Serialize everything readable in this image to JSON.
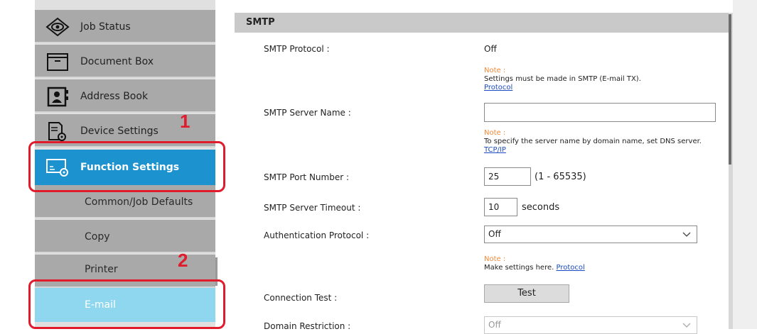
{
  "sidebar": {
    "items": [
      {
        "label": "Job Status",
        "icon": "eye-icon"
      },
      {
        "label": "Document Box",
        "icon": "folder-icon"
      },
      {
        "label": "Address Book",
        "icon": "address-book-icon"
      },
      {
        "label": "Device Settings",
        "icon": "device-settings-icon"
      },
      {
        "label": "Function Settings",
        "icon": "function-settings-icon",
        "active": true
      },
      {
        "label": "Common/Job Defaults"
      },
      {
        "label": "Copy"
      },
      {
        "label": "Printer"
      },
      {
        "label": "E-mail",
        "selected": true
      }
    ]
  },
  "callouts": {
    "one": "1",
    "two": "2"
  },
  "section": {
    "title": "SMTP"
  },
  "fields": {
    "smtp_protocol": {
      "label": "SMTP Protocol :",
      "value": "Off",
      "note_title": "Note :",
      "note_text": "Settings must be made in SMTP (E-mail TX).",
      "note_link": "Protocol"
    },
    "server_name": {
      "label": "SMTP Server Name :",
      "value": "",
      "note_title": "Note :",
      "note_text": "To specify the server name by domain name, set DNS server.",
      "note_link": "TCP/IP"
    },
    "port": {
      "label": "SMTP Port Number :",
      "value": "25",
      "range": "(1 - 65535)"
    },
    "timeout": {
      "label": "SMTP Server Timeout :",
      "value": "10",
      "unit": "seconds"
    },
    "auth": {
      "label": "Authentication Protocol :",
      "value": "Off",
      "note_title": "Note :",
      "note_text": "Make settings here.",
      "note_link": "Protocol"
    },
    "conn_test": {
      "label": "Connection Test :",
      "button": "Test"
    },
    "domain": {
      "label": "Domain Restriction :",
      "value": "Off"
    }
  },
  "colors": {
    "active": "#1c92cf",
    "selected": "#8fd7ee",
    "callout": "#e01b2b",
    "note": "#f08a3a"
  }
}
